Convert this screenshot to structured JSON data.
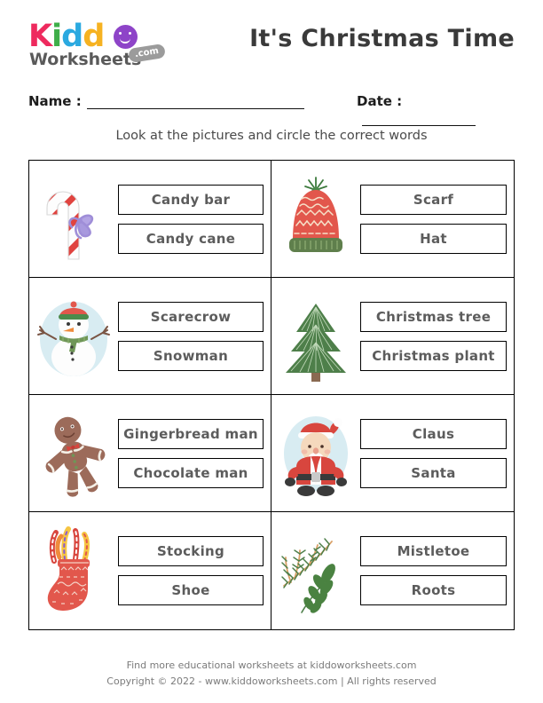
{
  "logo": {
    "word_parts": [
      "K",
      "i",
      "d",
      "d"
    ],
    "circle_letter": "o",
    "subtitle": "Worksheets",
    "badge": ".com",
    "colors": {
      "k": "#ee2a5e",
      "i": "#3fae49",
      "d1": "#2ba9e0",
      "d2": "#f6b221",
      "o": "#8e44c8",
      "subtitle": "#5a5a5a",
      "badge_bg": "#9b9b9b"
    }
  },
  "header": {
    "title": "It's Christmas Time"
  },
  "fields": {
    "name_label": "Name :",
    "name_value": "",
    "date_label": "Date :",
    "date_value": ""
  },
  "instruction": "Look at the pictures and circle the correct words",
  "grid": {
    "cells": [
      {
        "picture": "candy-cane",
        "options": [
          "Candy bar",
          "Candy cane"
        ]
      },
      {
        "picture": "winter-hat",
        "options": [
          "Scarf",
          "Hat"
        ]
      },
      {
        "picture": "snowman",
        "options": [
          "Scarecrow",
          "Snowman"
        ]
      },
      {
        "picture": "christmas-tree",
        "options": [
          "Christmas tree",
          "Christmas plant"
        ]
      },
      {
        "picture": "gingerbread-man",
        "options": [
          "Gingerbread man",
          "Chocolate man"
        ]
      },
      {
        "picture": "santa-claus",
        "options": [
          "Claus",
          "Santa"
        ]
      },
      {
        "picture": "stocking",
        "options": [
          "Stocking",
          "Shoe"
        ]
      },
      {
        "picture": "mistletoe-branch",
        "options": [
          "Mistletoe",
          "Roots"
        ]
      }
    ]
  },
  "footer": {
    "line1": "Find more educational worksheets at kiddoworksheets.com",
    "line2": "Copyright © 2022 - www.kiddoworksheets.com  |  All rights reserved"
  }
}
